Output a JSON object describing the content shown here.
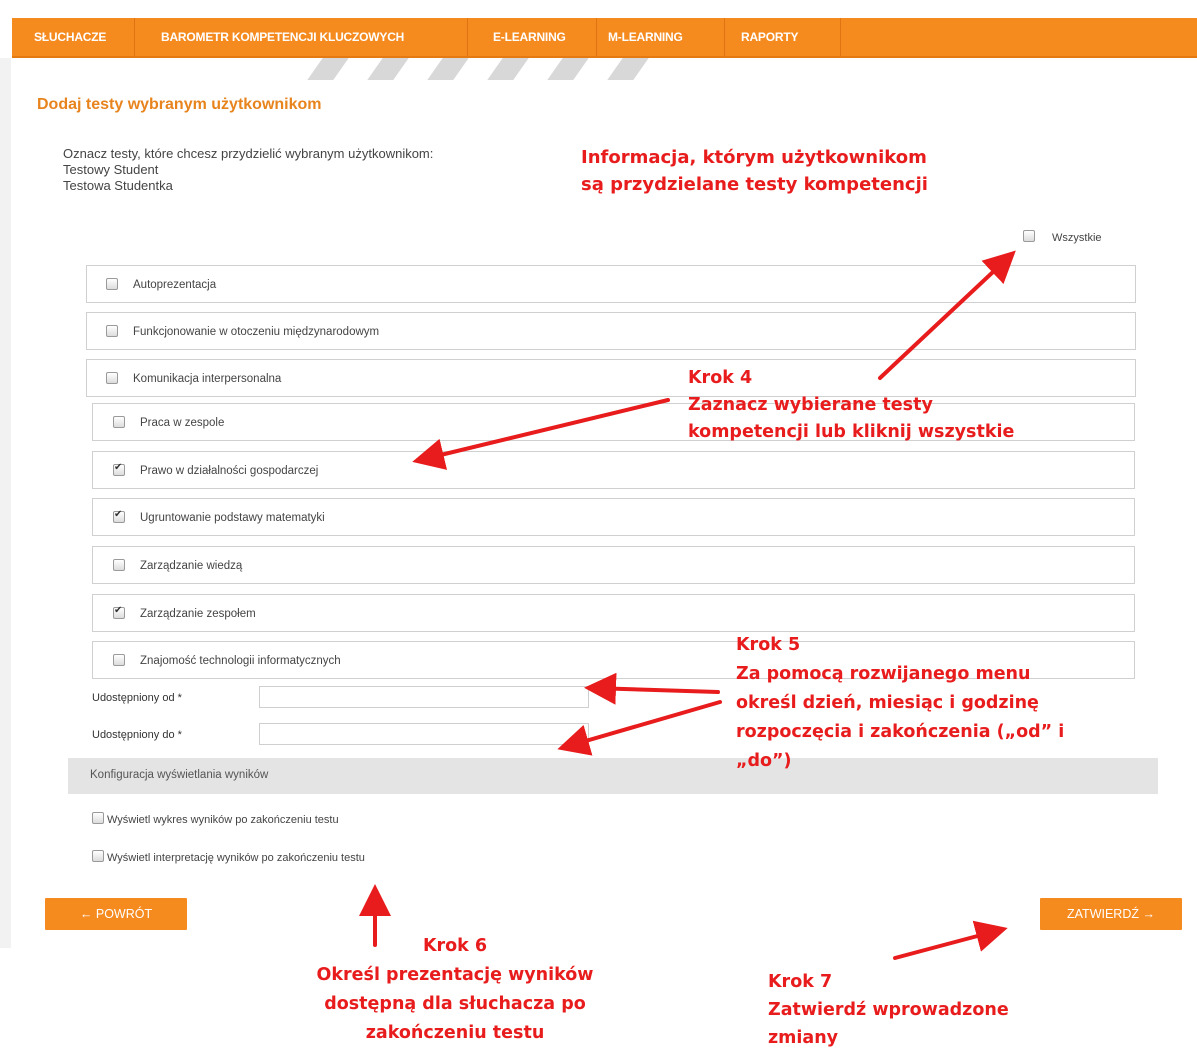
{
  "nav": {
    "items": [
      "SŁUCHACZE",
      "BAROMETR KOMPETENCJI KLUCZOWYCH",
      "E-LEARNING",
      "M-LEARNING",
      "RAPORTY"
    ]
  },
  "page_title": "Dodaj testy wybranym użytkownikom",
  "description": {
    "prompt": "Oznacz testy, które chcesz przydzielić wybranym użytkownikom:",
    "users": [
      "Testowy Student",
      "Testowa Studentka"
    ]
  },
  "select_all": {
    "label": "Wszystkie",
    "checked": false
  },
  "tests": [
    {
      "label": "Autoprezentacja",
      "checked": false
    },
    {
      "label": "Funkcjonowanie w otoczeniu międzynarodowym",
      "checked": false
    },
    {
      "label": "Komunikacja interpersonalna",
      "checked": false
    },
    {
      "label": "Praca w zespole",
      "checked": false
    },
    {
      "label": "Prawo w działalności gospodarczej",
      "checked": true
    },
    {
      "label": "Ugruntowanie podstawy matematyki",
      "checked": true
    },
    {
      "label": "Zarządzanie wiedzą",
      "checked": false
    },
    {
      "label": "Zarządzanie zespołem",
      "checked": true
    },
    {
      "label": "Znajomość technologii informatycznych",
      "checked": false
    }
  ],
  "fields": {
    "from_label": "Udostępniony od *",
    "from_value": "",
    "to_label": "Udostępniony do *",
    "to_value": ""
  },
  "config": {
    "title": "Konfiguracja wyświetlania wyników",
    "opt_chart": "Wyświetl wykres wyników po zakończeniu testu",
    "opt_interpretation": "Wyświetl interpretację wyników po zakończeniu testu"
  },
  "buttons": {
    "back": "← POWRÓT",
    "confirm": "ZATWIERDŹ →"
  },
  "annotations": {
    "info_line1": "Informacja, którym użytkownikom",
    "info_line2": "są przydzielane testy kompetencji",
    "step4_line1": "Krok 4",
    "step4_line2": "Zaznacz wybierane testy",
    "step4_line3": "kompetencji lub kliknij  wszystkie",
    "step5_line1": "Krok 5",
    "step5_line2": "Za pomocą rozwijanego menu",
    "step5_line3": "określ dzień, miesiąc i godzinę",
    "step5_line4": "rozpoczęcia i zakończenia  („od” i",
    "step5_line5": "„do”)",
    "step6_line1": "Krok 6",
    "step6_line2": "Określ prezentację wyników",
    "step6_line3": "dostępną dla słuchacza po",
    "step6_line4": "zakończeniu testu",
    "step7_line1": "Krok 7",
    "step7_line2": "Zatwierdź wprowadzone",
    "step7_line3": "zmiany"
  },
  "colors": {
    "accent": "#f58a1f",
    "title": "#e8841e",
    "annotation": "#e81c1c"
  }
}
